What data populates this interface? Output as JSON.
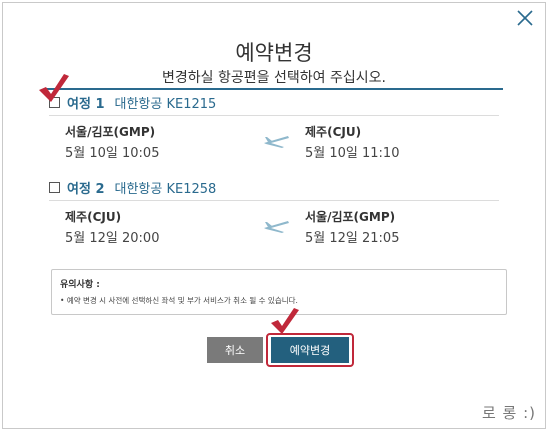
{
  "modal": {
    "title": "예약변경",
    "subtitle": "변경하실 항공편을 선택하여 주십시오."
  },
  "segments": [
    {
      "label": "여정 1",
      "flight": "대한항공 KE1215",
      "checked": true,
      "departure": {
        "airport": "서울/김포(GMP)",
        "datetime": "5월 10일 10:05"
      },
      "arrival": {
        "airport": "제주(CJU)",
        "datetime": "5월 10일 11:10"
      }
    },
    {
      "label": "여정 2",
      "flight": "대한항공 KE1258",
      "checked": false,
      "departure": {
        "airport": "제주(CJU)",
        "datetime": "5월 12일 20:00"
      },
      "arrival": {
        "airport": "서울/김포(GMP)",
        "datetime": "5월 12일 21:05"
      }
    }
  ],
  "notice": {
    "title": "유의사항 :",
    "items": [
      "예약 변경 시 사전에 선택하신 좌석 및 부가 서비스가 취소 될 수 있습니다."
    ]
  },
  "buttons": {
    "cancel": "취소",
    "change": "예약변경"
  },
  "footer": {
    "text": "로 롱 :)"
  },
  "colors": {
    "accent": "#2a6a8e",
    "primary_button": "#23607e",
    "cancel_button": "#7a7a7a",
    "highlight": "#c0283a",
    "check_mark": "#c0283a",
    "plane_icon": "#8fb8cc"
  },
  "icons": {
    "close": "close-icon",
    "plane": "plane-icon",
    "check": "check-mark-icon"
  }
}
